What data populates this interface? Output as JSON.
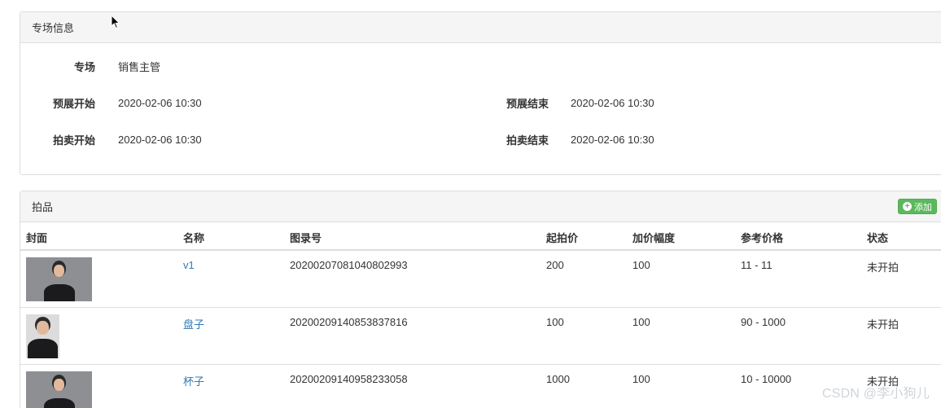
{
  "info_panel": {
    "title": "专场信息",
    "session_label": "专场",
    "session_value": "销售主管",
    "preview_start_label": "预展开始",
    "preview_start_value": "2020-02-06 10:30",
    "preview_end_label": "预展结束",
    "preview_end_value": "2020-02-06 10:30",
    "auction_start_label": "拍卖开始",
    "auction_start_value": "2020-02-06 10:30",
    "auction_end_label": "拍卖结束",
    "auction_end_value": "2020-02-06 10:30"
  },
  "lots_panel": {
    "title": "拍品",
    "add_button": "添加",
    "columns": [
      "封面",
      "名称",
      "图录号",
      "起拍价",
      "加价幅度",
      "参考价格",
      "状态"
    ],
    "rows": [
      {
        "name": "v1",
        "catalog_no": "20200207081040802993",
        "start_price": "200",
        "increment": "100",
        "ref_price": "11 - 11",
        "status": "未开拍"
      },
      {
        "name": "盘子",
        "catalog_no": "20200209140853837816",
        "start_price": "100",
        "increment": "100",
        "ref_price": "90 - 1000",
        "status": "未开拍"
      },
      {
        "name": "杯子",
        "catalog_no": "20200209140958233058",
        "start_price": "1000",
        "increment": "100",
        "ref_price": "10 - 10000",
        "status": "未开拍"
      }
    ]
  },
  "watermark": "CSDN @李小狗儿",
  "colors": {
    "link": "#337ab7",
    "add_button": "#5cb85c",
    "heading_bg": "#f5f5f5",
    "border": "#dddddd"
  }
}
